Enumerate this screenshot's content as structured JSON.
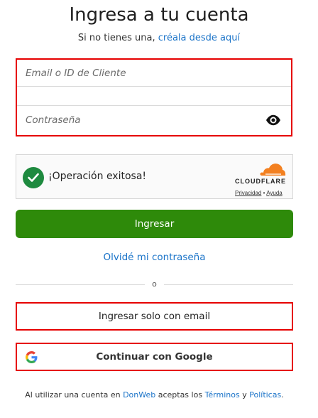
{
  "header": {
    "title": "Ingresa a tu cuenta",
    "subtitle_prefix": "Si no tienes una,",
    "subtitle_link": "créala desde aquí"
  },
  "form": {
    "email_placeholder": "Email o ID de Cliente",
    "password_placeholder": "Contraseña",
    "eye_icon": "eye-icon"
  },
  "captcha": {
    "status_text": "¡Operación exitosa!",
    "brand": "CLOUDFLARE",
    "privacy_link": "Privacidad",
    "separator": "•",
    "help_link": "Ayuda",
    "status_color": "#1e8a3f",
    "brand_color": "#f38020"
  },
  "actions": {
    "login_button": "Ingresar",
    "login_color": "#2e8a0a",
    "forgot_link": "Olvidé mi contraseña",
    "divider_text": "o",
    "email_only_button": "Ingresar solo con email",
    "google_button": "Continuar con Google"
  },
  "footer": {
    "text_1": "Al utilizar una cuenta en",
    "brand_link": "DonWeb",
    "text_2": "aceptas los",
    "terms_link": "Términos",
    "text_3": "y",
    "policies_link": "Políticas",
    "text_4": "."
  }
}
